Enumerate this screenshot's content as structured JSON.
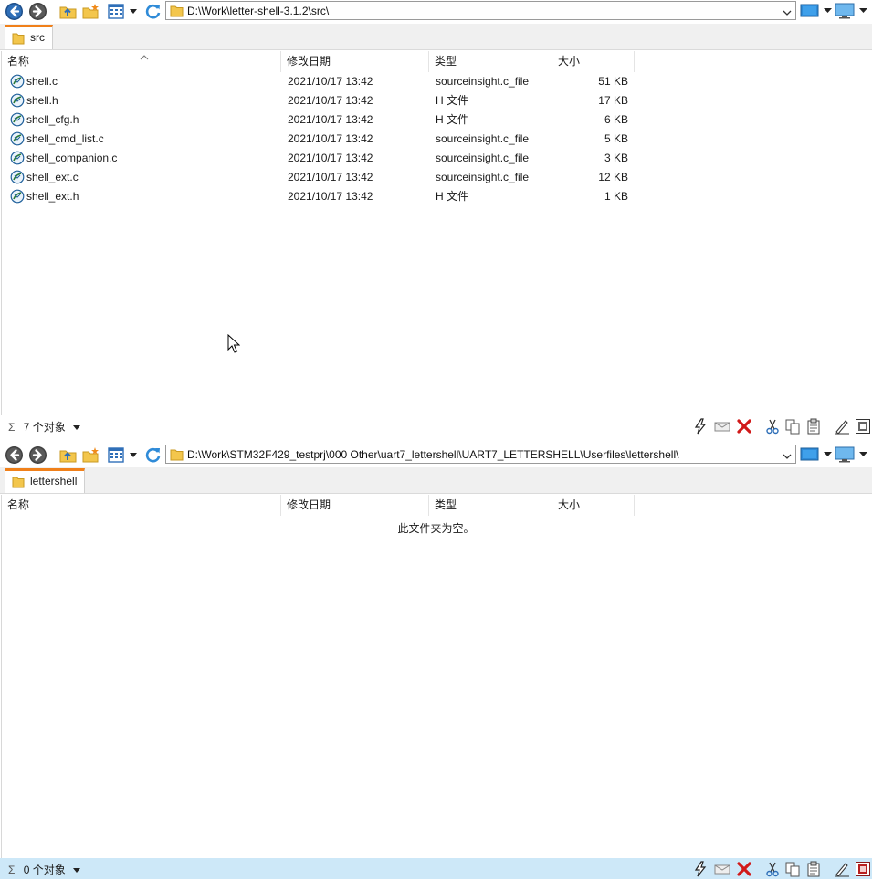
{
  "panes": [
    {
      "address": "D:\\Work\\letter-shell-3.1.2\\src\\",
      "tab_label": "src",
      "columns": [
        "名称",
        "修改日期",
        "类型",
        "大小"
      ],
      "rows": [
        {
          "name": "shell.c",
          "date": "2021/10/17 13:42",
          "type": "sourceinsight.c_file",
          "size": "51 KB"
        },
        {
          "name": "shell.h",
          "date": "2021/10/17 13:42",
          "type": "H 文件",
          "size": "17 KB"
        },
        {
          "name": "shell_cfg.h",
          "date": "2021/10/17 13:42",
          "type": "H 文件",
          "size": "6 KB"
        },
        {
          "name": "shell_cmd_list.c",
          "date": "2021/10/17 13:42",
          "type": "sourceinsight.c_file",
          "size": "5 KB"
        },
        {
          "name": "shell_companion.c",
          "date": "2021/10/17 13:42",
          "type": "sourceinsight.c_file",
          "size": "3 KB"
        },
        {
          "name": "shell_ext.c",
          "date": "2021/10/17 13:42",
          "type": "sourceinsight.c_file",
          "size": "12 KB"
        },
        {
          "name": "shell_ext.h",
          "date": "2021/10/17 13:42",
          "type": "H 文件",
          "size": "1 KB"
        }
      ],
      "status": "7 个对象",
      "status_bg": "#ffffff"
    },
    {
      "address": "D:\\Work\\STM32F429_testprj\\000 Other\\uart7_lettershell\\UART7_LETTERSHELL\\Userfiles\\lettershell\\",
      "tab_label": "lettershell",
      "columns": [
        "名称",
        "修改日期",
        "类型",
        "大小"
      ],
      "empty_message": "此文件夹为空。",
      "status": "0 个对象",
      "status_bg": "#cde8f8"
    }
  ],
  "status_symbol": "Σ",
  "icons": {
    "back": "back-arrow-icon",
    "forward": "forward-arrow-icon",
    "up": "up-folder-icon",
    "new_folder": "new-folder-icon",
    "view": "view-mode-icon",
    "refresh": "refresh-icon"
  },
  "colors": {
    "tab_accent": "#f0801a",
    "nav_blue": "#1e4f8a",
    "delete_red": "#d11a1a",
    "folder_yellow": "#f3c64c"
  }
}
